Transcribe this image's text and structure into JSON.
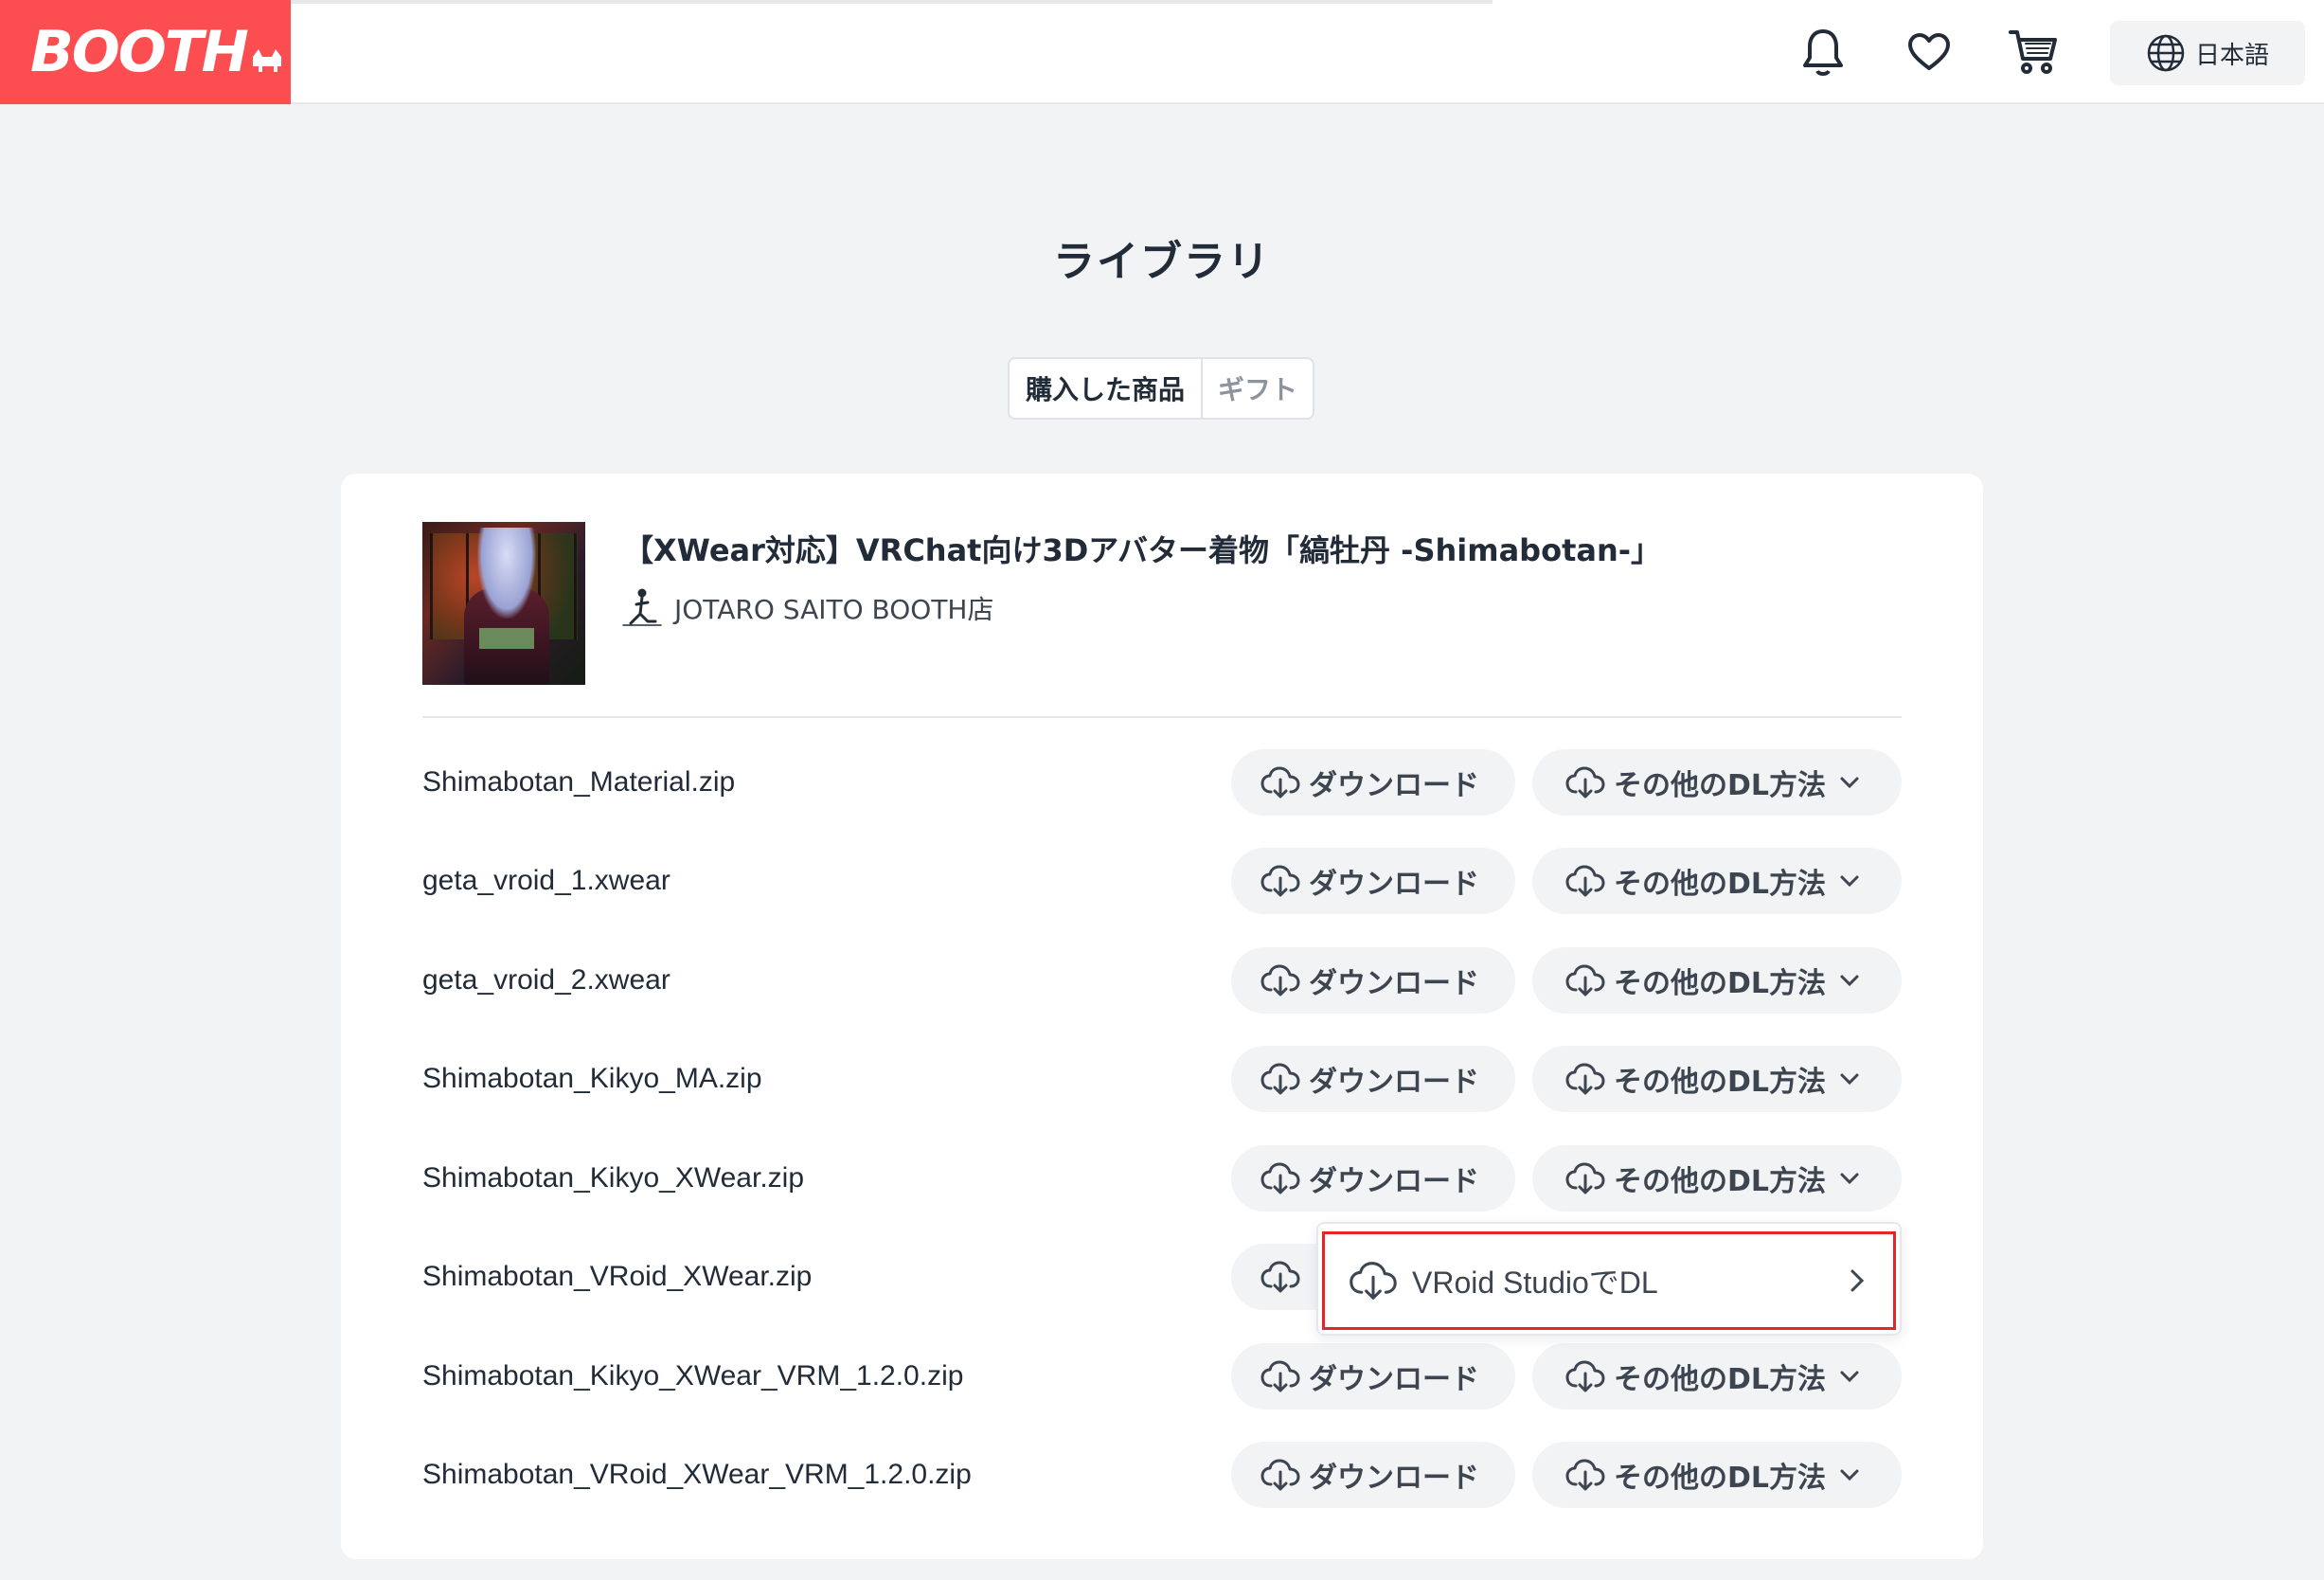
{
  "header": {
    "logo_text": "BOOTH",
    "icons": [
      "bell-icon",
      "heart-icon",
      "cart-icon",
      "globe-icon"
    ],
    "language_label": "日本語"
  },
  "page": {
    "title": "ライブラリ",
    "tabs": [
      {
        "label": "購入した商品",
        "active": true
      },
      {
        "label": "ギフト",
        "active": false
      }
    ]
  },
  "product": {
    "title": "【XWear対応】VRChat向け3Dアバター着物「縞牡丹 -Shimabotan-」",
    "shop_name": "JOTARO SAITO BOOTH店"
  },
  "buttons": {
    "download_label": "ダウンロード",
    "other_dl_label": "その他のDL方法"
  },
  "files": [
    {
      "name": "Shimabotan_Material.zip"
    },
    {
      "name": "geta_vroid_1.xwear"
    },
    {
      "name": "geta_vroid_2.xwear"
    },
    {
      "name": "Shimabotan_Kikyo_MA.zip"
    },
    {
      "name": "Shimabotan_Kikyo_XWear.zip"
    },
    {
      "name": "Shimabotan_VRoid_XWear.zip"
    },
    {
      "name": "Shimabotan_Kikyo_XWear_VRM_1.2.0.zip"
    },
    {
      "name": "Shimabotan_VRoid_XWear_VRM_1.2.0.zip"
    }
  ],
  "dropdown": {
    "item_label": "VRoid StudioでDL"
  },
  "colors": {
    "brand": "#fc4d50",
    "highlight_border": "#e52629",
    "background": "#f1f3f5"
  }
}
